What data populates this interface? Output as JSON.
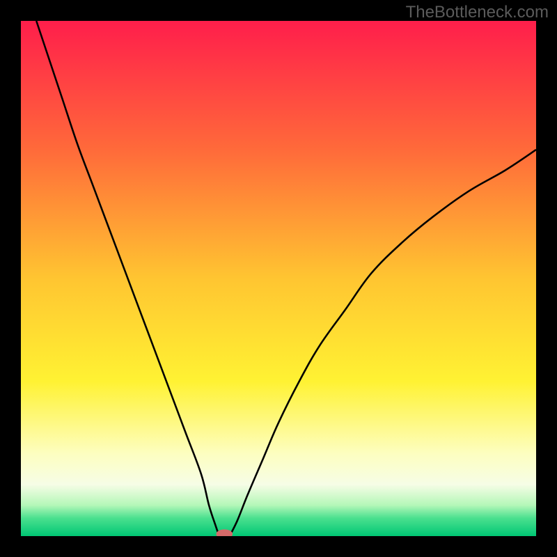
{
  "watermark": "TheBottleneck.com",
  "colors": {
    "black": "#000000",
    "curve": "#000000",
    "marker": "#d66a6a"
  },
  "chart_data": {
    "type": "line",
    "title": "",
    "xlabel": "",
    "ylabel": "",
    "xlim": [
      0,
      100
    ],
    "ylim": [
      0,
      100
    ],
    "gradient_stops": [
      {
        "offset": 0,
        "color": "#ff1e4b"
      },
      {
        "offset": 0.25,
        "color": "#ff6a3a"
      },
      {
        "offset": 0.5,
        "color": "#ffc531"
      },
      {
        "offset": 0.7,
        "color": "#fff233"
      },
      {
        "offset": 0.84,
        "color": "#fdfec0"
      },
      {
        "offset": 0.9,
        "color": "#f6fde6"
      },
      {
        "offset": 0.94,
        "color": "#b4f7b8"
      },
      {
        "offset": 0.965,
        "color": "#4be08f"
      },
      {
        "offset": 1.0,
        "color": "#00c774"
      }
    ],
    "curve_left": {
      "x": [
        3,
        5,
        8,
        11,
        14,
        17,
        20,
        23,
        26,
        29,
        32,
        35,
        36.5,
        37.8,
        38.5
      ],
      "y": [
        100,
        94,
        85,
        76,
        68,
        60,
        52,
        44,
        36,
        28,
        20,
        12,
        6,
        2,
        0
      ]
    },
    "curve_right": {
      "x": [
        40.5,
        42,
        44,
        47,
        50,
        54,
        58,
        63,
        68,
        74,
        80,
        87,
        94,
        100
      ],
      "y": [
        0,
        3,
        8,
        15,
        22,
        30,
        37,
        44,
        51,
        57,
        62,
        67,
        71,
        75
      ]
    },
    "minimum_marker": {
      "x": 39.5,
      "y": 0,
      "rx": 1.6,
      "ry": 0.9
    }
  }
}
